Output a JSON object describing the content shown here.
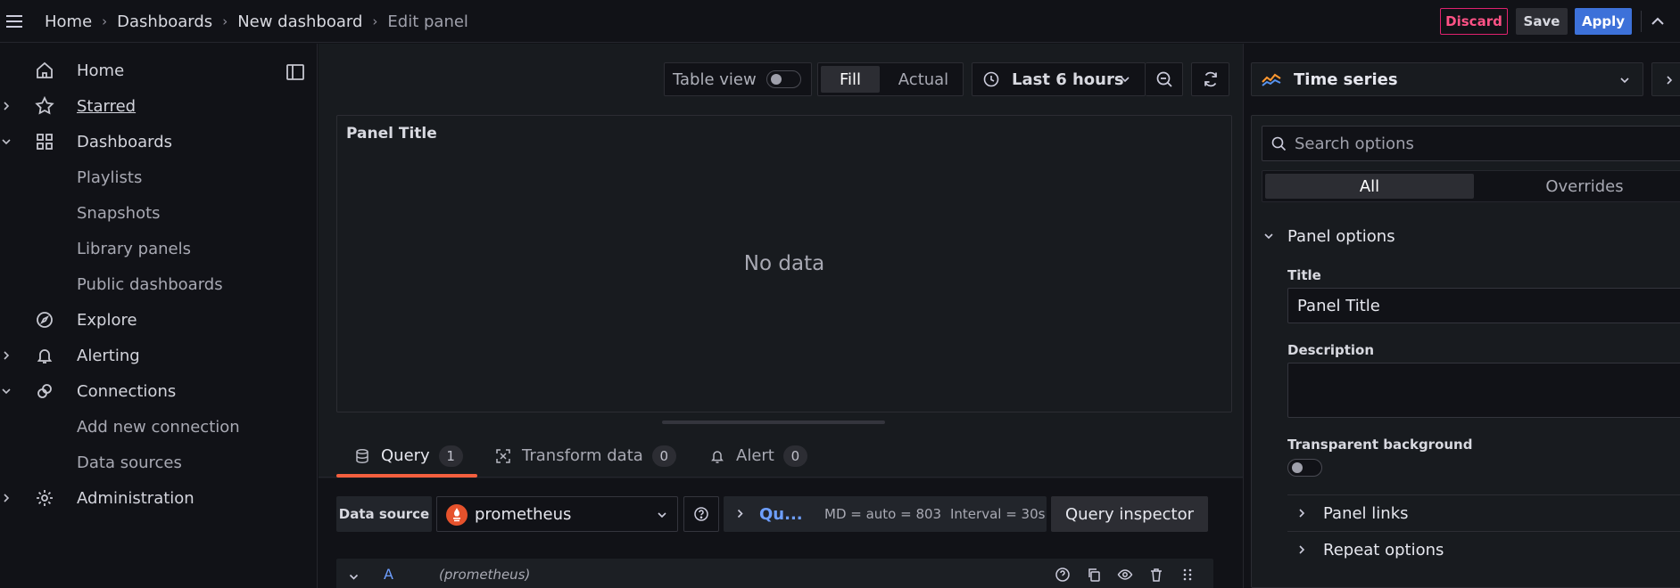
{
  "breadcrumb": [
    {
      "label": "Home"
    },
    {
      "label": "Dashboards"
    },
    {
      "label": "New dashboard"
    },
    {
      "label": "Edit panel"
    }
  ],
  "actions": {
    "discard": "Discard",
    "save": "Save",
    "apply": "Apply"
  },
  "sidebar": {
    "items": [
      {
        "label": "Home",
        "icon": "home-icon"
      },
      {
        "label": "Starred",
        "icon": "star-icon"
      },
      {
        "label": "Dashboards",
        "icon": "apps-icon"
      },
      {
        "label": "Playlists"
      },
      {
        "label": "Snapshots"
      },
      {
        "label": "Library panels"
      },
      {
        "label": "Public dashboards"
      },
      {
        "label": "Explore",
        "icon": "compass-icon"
      },
      {
        "label": "Alerting",
        "icon": "bell-icon"
      },
      {
        "label": "Connections",
        "icon": "plug-icon"
      },
      {
        "label": "Add new connection"
      },
      {
        "label": "Data sources"
      },
      {
        "label": "Administration",
        "icon": "cog-icon"
      }
    ]
  },
  "toolbar": {
    "table_view": "Table view",
    "fill": "Fill",
    "actual": "Actual",
    "time_range": "Last 6 hours"
  },
  "panel": {
    "title": "Panel Title",
    "empty_text": "No data"
  },
  "tabs": [
    {
      "label": "Query",
      "count": "1"
    },
    {
      "label": "Transform data",
      "count": "0"
    },
    {
      "label": "Alert",
      "count": "0"
    }
  ],
  "query": {
    "data_source_label": "Data source",
    "data_source": "prometheus",
    "options_label": "Qu...",
    "max_data_points": "MD = auto = 803",
    "interval": "Interval = 30s",
    "inspector": "Query inspector",
    "row_letter": "A",
    "row_datasource": "(prometheus)"
  },
  "viz": {
    "selected": "Time series"
  },
  "options": {
    "search_placeholder": "Search options",
    "all": "All",
    "overrides": "Overrides",
    "panel_options": "Panel options",
    "title_label": "Title",
    "title_value": "Panel Title",
    "description_label": "Description",
    "description_value": "",
    "transparent_label": "Transparent background",
    "panel_links": "Panel links",
    "repeat_options": "Repeat options"
  },
  "colors": {
    "accent_blue": "#3d71d9",
    "discard_red": "#ff5286",
    "tab_underline": "#f55f3e",
    "link_blue": "#6e9fff",
    "prometheus_orange": "#e6522c"
  }
}
